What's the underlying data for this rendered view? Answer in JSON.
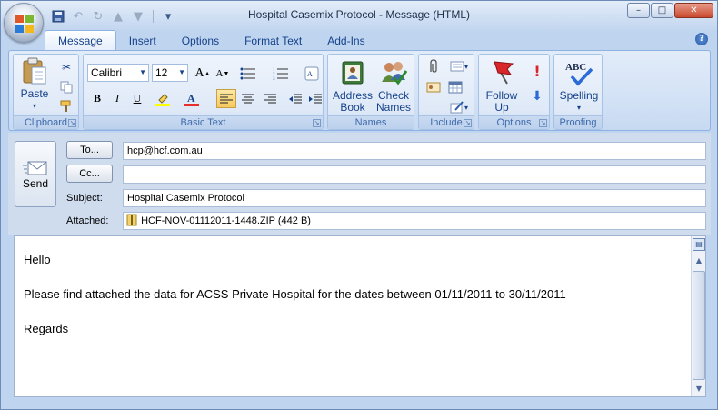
{
  "window": {
    "title": "Hospital Casemix Protocol - Message (HTML)",
    "controls": {
      "minimize": "–",
      "maximize": "□",
      "close": "✕"
    }
  },
  "quick_access": {
    "customize": "▾"
  },
  "tabs": [
    "Message",
    "Insert",
    "Options",
    "Format Text",
    "Add-Ins"
  ],
  "help_label": "?",
  "ribbon": {
    "clipboard": {
      "label": "Clipboard",
      "paste": "Paste"
    },
    "basic_text": {
      "label": "Basic Text",
      "font": "Calibri",
      "size": "12",
      "bold": "B",
      "italic": "I",
      "underline": "U",
      "grow": "A",
      "shrink": "A"
    },
    "names": {
      "label": "Names",
      "address_book": "Address\nBook",
      "check_names": "Check\nNames"
    },
    "include": {
      "label": "Include"
    },
    "options": {
      "label": "Options",
      "follow_up": "Follow\nUp"
    },
    "proofing": {
      "label": "Proofing",
      "spelling": "Spelling",
      "spell_icon_text": "ABC"
    }
  },
  "header": {
    "send_label": "Send",
    "to_button": "To...",
    "cc_button": "Cc...",
    "to_value": "hcp@hcf.com.au",
    "cc_value": "",
    "subject_label": "Subject:",
    "subject_value": "Hospital Casemix Protocol",
    "attached_label": "Attached:",
    "attachment": "HCF-NOV-01112011-1448.ZIP (442 B)"
  },
  "body": {
    "greeting": "Hello",
    "message": "Please find attached the data for ACSS Private Hospital for the dates between 01/11/2011 to 30/11/2011",
    "signoff": "Regards"
  },
  "colors": {
    "ribbon_text": "#15428b",
    "group_label": "#3e6aaa",
    "highlight_on": "#f7c95c",
    "flag_red": "#d9262b"
  }
}
